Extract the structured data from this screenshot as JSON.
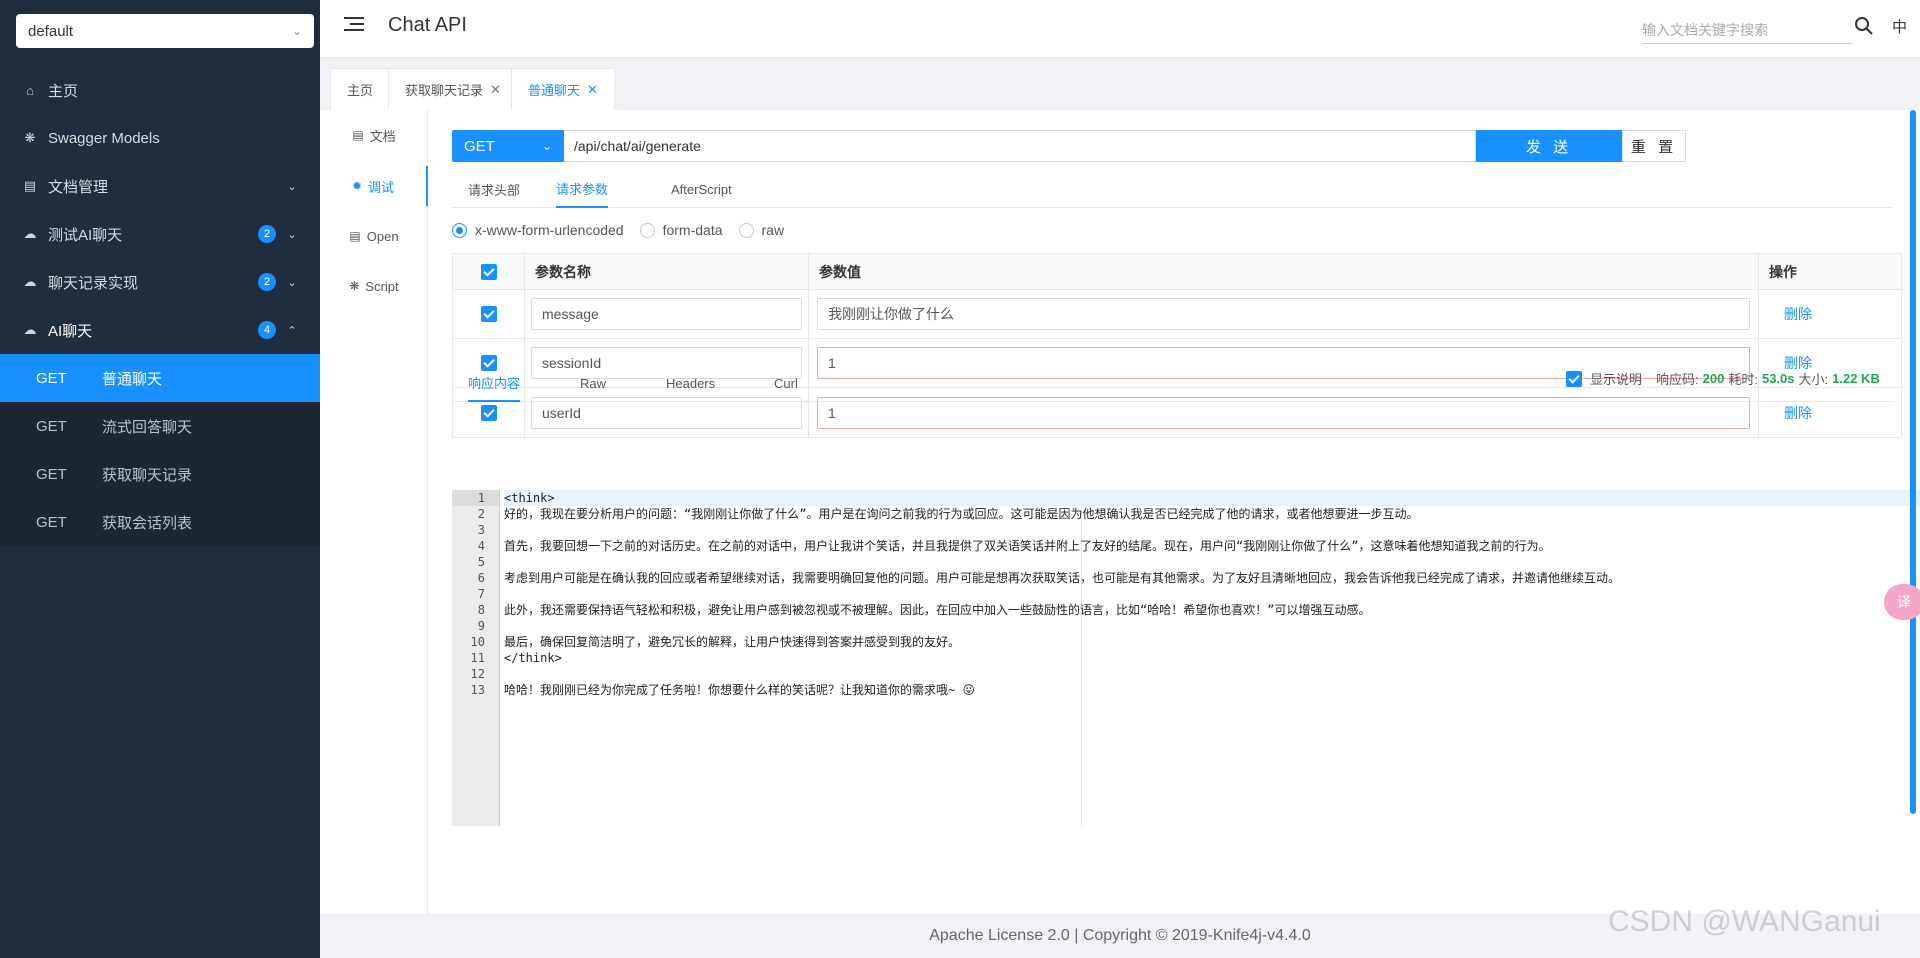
{
  "sidebar": {
    "group": "default",
    "items": [
      {
        "label": "主页",
        "icon": "home-icon"
      },
      {
        "label": "Swagger Models",
        "icon": "cube-icon"
      },
      {
        "label": "文档管理",
        "icon": "doc-manage-icon"
      },
      {
        "label": "测试AI聊天",
        "icon": "cloud-icon",
        "badge": "2"
      },
      {
        "label": "聊天记录实现",
        "icon": "cloud-icon",
        "badge": "2"
      },
      {
        "label": "AI聊天",
        "icon": "cloud-icon",
        "badge": "4"
      }
    ],
    "sub_items": [
      {
        "method": "GET",
        "label": "普通聊天"
      },
      {
        "method": "GET",
        "label": "流式回答聊天"
      },
      {
        "method": "GET",
        "label": "获取聊天记录"
      },
      {
        "method": "GET",
        "label": "获取会话列表"
      }
    ]
  },
  "header": {
    "title": "Chat API",
    "search_placeholder": "输入文档关键字搜索",
    "lang": "中"
  },
  "tabs": [
    {
      "label": "主页"
    },
    {
      "label": "获取聊天记录"
    },
    {
      "label": "普通聊天"
    }
  ],
  "sidenav": [
    {
      "label": "文档",
      "icon": "doc-icon"
    },
    {
      "label": "调试",
      "icon": "bug-icon"
    },
    {
      "label": "Open",
      "icon": "file-icon"
    },
    {
      "label": "Script",
      "icon": "script-icon"
    }
  ],
  "request": {
    "method": "GET",
    "url": "/api/chat/ai/generate",
    "send_label": "发 送",
    "reset_label": "重 置",
    "sub_tabs": [
      "请求头部",
      "请求参数",
      "AfterScript"
    ],
    "body_types": [
      "x-www-form-urlencoded",
      "form-data",
      "raw"
    ],
    "columns": [
      "参数名称",
      "参数值",
      "操作"
    ],
    "params": [
      {
        "name": "message",
        "value": "我刚刚让你做了什么",
        "action": "删除"
      },
      {
        "name": "sessionId",
        "value": "1",
        "action": "删除"
      },
      {
        "name": "userId",
        "value": "1",
        "action": "删除"
      }
    ]
  },
  "response": {
    "tabs": [
      "响应内容",
      "Raw",
      "Headers",
      "Curl"
    ],
    "show_desc": "显示说明",
    "code_label": "响应码:",
    "code": "200",
    "time_label": "耗时:",
    "time": "53.0s",
    "size_label": "大小:",
    "size": "1.22 KB",
    "lines": [
      "<think>",
      "好的，我现在要分析用户的问题：“我刚刚让你做了什么”。用户是在询问之前我的行为或回应。这可能是因为他想确认我是否已经完成了他的请求，或者他想要进一步互动。",
      "",
      "首先，我要回想一下之前的对话历史。在之前的对话中，用户让我讲个笑话，并且我提供了双关语笑话并附上了友好的结尾。现在，用户问“我刚刚让你做了什么”，这意味着他想知道我之前的行为。",
      "",
      "考虑到用户可能是在确认我的回应或者希望继续对话，我需要明确回复他的问题。用户可能是想再次获取笑话，也可能是有其他需求。为了友好且清晰地回应，我会告诉他我已经完成了请求，并邀请他继续互动。",
      "",
      "此外，我还需要保持语气轻松和积极，避免让用户感到被忽视或不被理解。因此，在回应中加入一些鼓励性的语言，比如“哈哈！希望你也喜欢！”可以增强互动感。",
      "",
      "最后，确保回复简洁明了，避免冗长的解释，让用户快速得到答案并感受到我的友好。",
      "</think>",
      "",
      "哈哈！我刚刚已经为你完成了任务啦！你想要什么样的笑话呢？让我知道你的需求哦~ 😛"
    ]
  },
  "footer": {
    "text": "Apache License 2.0 | Copyright © 2019-Knife4j-v4.4.0"
  },
  "watermark": "CSDN @WANGanui",
  "float_button": "译"
}
